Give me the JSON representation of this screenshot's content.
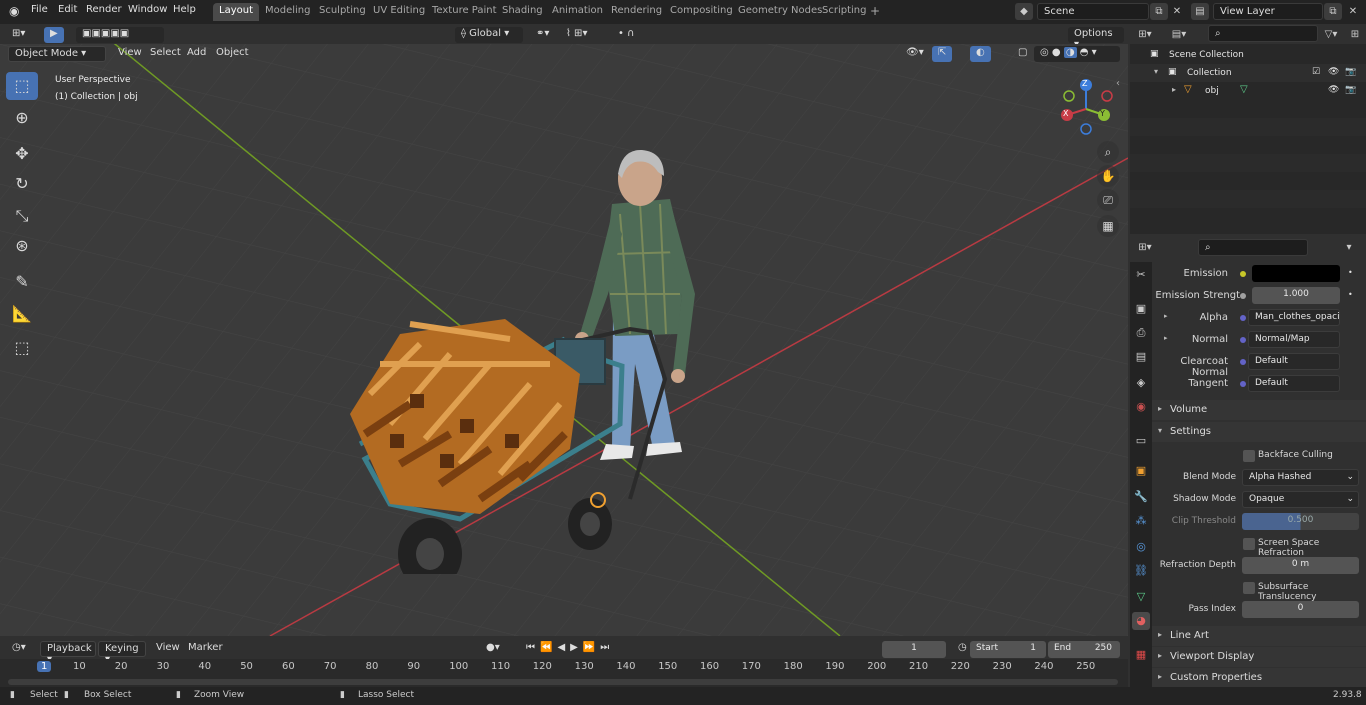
{
  "topbar": {
    "menus": [
      "File",
      "Edit",
      "Render",
      "Window",
      "Help"
    ],
    "workspace_tabs": [
      "Layout",
      "Modeling",
      "Sculpting",
      "UV Editing",
      "Texture Paint",
      "Shading",
      "Animation",
      "Rendering",
      "Compositing",
      "Geometry Nodes",
      "Scripting"
    ],
    "active_tab": "Layout",
    "scene": "Scene",
    "view_layer": "View Layer"
  },
  "viewport_header": {
    "mode": "Object Mode",
    "menus": [
      "View",
      "Select",
      "Add",
      "Object"
    ],
    "orientation": "Global",
    "options": "Options"
  },
  "viewport": {
    "perspective_label": "User Perspective",
    "collection_label": "(1) Collection | obj",
    "gizmo": {
      "x": "X",
      "y": "Y",
      "z": "Z"
    }
  },
  "outliner": {
    "scene_collection": "Scene Collection",
    "collection": "Collection",
    "object": "obj"
  },
  "properties": {
    "rows": [
      {
        "label": "Emission",
        "value": "",
        "socket": "#c7c729",
        "type": "color"
      },
      {
        "label": "Emission Strengt",
        "value": "1.000",
        "type": "number"
      },
      {
        "label": "Alpha",
        "value": "Man_clothes_opacit...",
        "socket": "#6363c7",
        "type": "link"
      },
      {
        "label": "Normal",
        "value": "Normal/Map",
        "socket": "#6363c7",
        "type": "link"
      },
      {
        "label": "Clearcoat Normal",
        "value": "Default",
        "socket": "#6363c7",
        "type": "link"
      },
      {
        "label": "Tangent",
        "value": "Default",
        "socket": "#6363c7",
        "type": "link"
      }
    ],
    "volume": "Volume",
    "settings": "Settings",
    "backface_culling": "Backface Culling",
    "blend_mode_label": "Blend Mode",
    "blend_mode": "Alpha Hashed",
    "shadow_mode_label": "Shadow Mode",
    "shadow_mode": "Opaque",
    "clip_threshold_label": "Clip Threshold",
    "clip_threshold": "0.500",
    "ssr_label": "Screen Space Refraction",
    "refraction_depth_label": "Refraction Depth",
    "refraction_depth": "0 m",
    "subsurface_label": "Subsurface Translucency",
    "pass_index_label": "Pass Index",
    "pass_index": "0",
    "line_art": "Line Art",
    "viewport_display": "Viewport Display",
    "custom_properties": "Custom Properties"
  },
  "timeline": {
    "menus": [
      "Playback",
      "Keying",
      "View",
      "Marker"
    ],
    "current_frame": "1",
    "start_label": "Start",
    "start": "1",
    "end_label": "End",
    "end": "250",
    "frames": [
      "1",
      "10",
      "20",
      "30",
      "40",
      "50",
      "60",
      "70",
      "80",
      "90",
      "100",
      "110",
      "120",
      "130",
      "140",
      "150",
      "160",
      "170",
      "180",
      "190",
      "200",
      "210",
      "220",
      "230",
      "240",
      "250"
    ]
  },
  "statusbar": {
    "select": "Select",
    "box_select": "Box Select",
    "zoom_view": "Zoom View",
    "lasso_select": "Lasso Select",
    "version": "2.93.8"
  },
  "colors": {
    "accent": "#4772b3",
    "x_axis": "#c83c46",
    "y_axis": "#8bbd34",
    "z_axis": "#3c7ddb"
  }
}
